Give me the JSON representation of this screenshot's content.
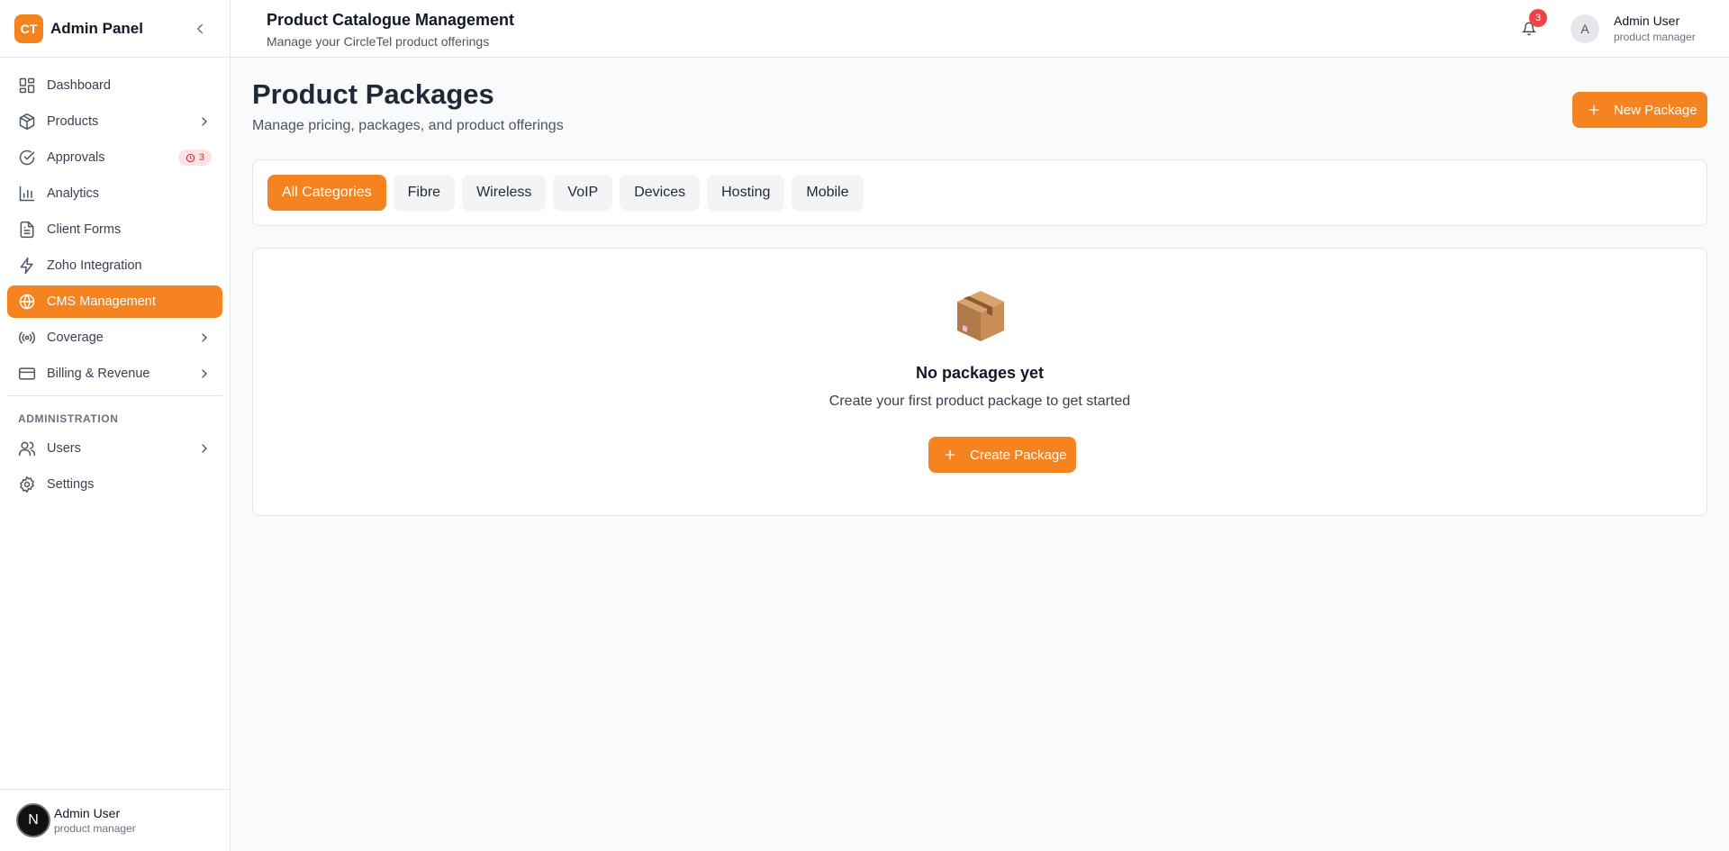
{
  "brand": {
    "logo_text": "CT",
    "title": "Admin Panel"
  },
  "sidebar": {
    "items": [
      {
        "label": "Dashboard",
        "icon": "dashboard-icon"
      },
      {
        "label": "Products",
        "icon": "package-icon",
        "has_submenu": true
      },
      {
        "label": "Approvals",
        "icon": "check-circle-icon",
        "badge": "3"
      },
      {
        "label": "Analytics",
        "icon": "bar-chart-icon"
      },
      {
        "label": "Client Forms",
        "icon": "file-text-icon"
      },
      {
        "label": "Zoho Integration",
        "icon": "zap-icon"
      },
      {
        "label": "CMS Management",
        "icon": "globe-icon",
        "active": true
      },
      {
        "label": "Coverage",
        "icon": "radio-icon",
        "has_submenu": true
      },
      {
        "label": "Billing & Revenue",
        "icon": "credit-card-icon",
        "has_submenu": true
      }
    ],
    "section_label": "ADMINISTRATION",
    "admin_items": [
      {
        "label": "Users",
        "icon": "users-icon",
        "has_submenu": true
      },
      {
        "label": "Settings",
        "icon": "settings-icon"
      }
    ],
    "footer": {
      "avatar": "N",
      "name": "Admin User",
      "role": "product manager"
    }
  },
  "header": {
    "title": "Product Catalogue Management",
    "subtitle": "Manage your CircleTel product offerings",
    "notification_count": "3",
    "user": {
      "avatar": "A",
      "name": "Admin User",
      "role": "product manager"
    }
  },
  "main": {
    "title": "Product Packages",
    "subtitle": "Manage pricing, packages, and product offerings",
    "new_button": "New Package",
    "categories": [
      "All Categories",
      "Fibre",
      "Wireless",
      "VoIP",
      "Devices",
      "Hosting",
      "Mobile"
    ],
    "active_category": "All Categories",
    "empty_state": {
      "title": "No packages yet",
      "description": "Create your first product package to get started",
      "button": "Create Package"
    }
  },
  "colors": {
    "accent": "#f5831f",
    "danger": "#ef4444"
  }
}
